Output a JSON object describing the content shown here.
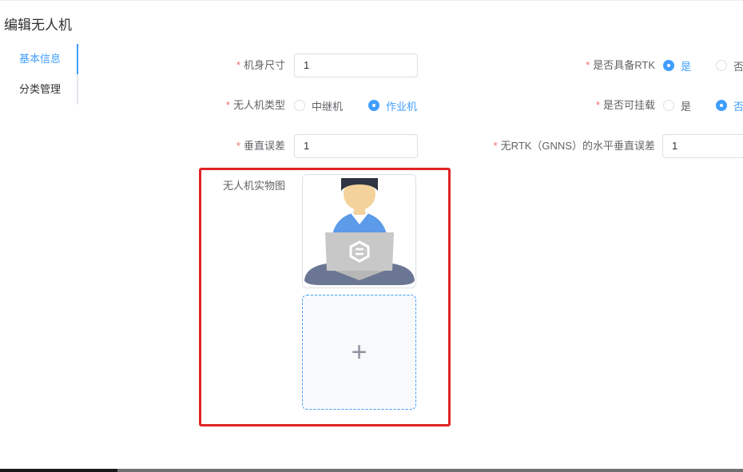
{
  "page": {
    "title": "编辑无人机"
  },
  "tabs": [
    {
      "label": "基本信息",
      "active": true
    },
    {
      "label": "分类管理",
      "active": false
    }
  ],
  "form": {
    "required_mark": "*",
    "body_size": {
      "label": "机身尺寸",
      "value": "1"
    },
    "has_rtk": {
      "label": "是否具备RTK",
      "options": [
        "是",
        "否"
      ],
      "selected": "是"
    },
    "drone_type": {
      "label": "无人机类型",
      "options": [
        "中继机",
        "作业机"
      ],
      "selected": "作业机"
    },
    "mountable": {
      "label": "是否可挂载",
      "options": [
        "是",
        "否"
      ],
      "selected": "否"
    },
    "vertical_error": {
      "label": "垂直误差",
      "value": "1"
    },
    "no_rtk_error": {
      "label": "无RTK（GNNS）的水平垂直误差",
      "value": "1"
    },
    "photo": {
      "label": "无人机实物图",
      "add_icon": "plus-icon"
    }
  },
  "colors": {
    "accent": "#409eff",
    "required": "#f56c6c",
    "highlight": "#e02424"
  }
}
